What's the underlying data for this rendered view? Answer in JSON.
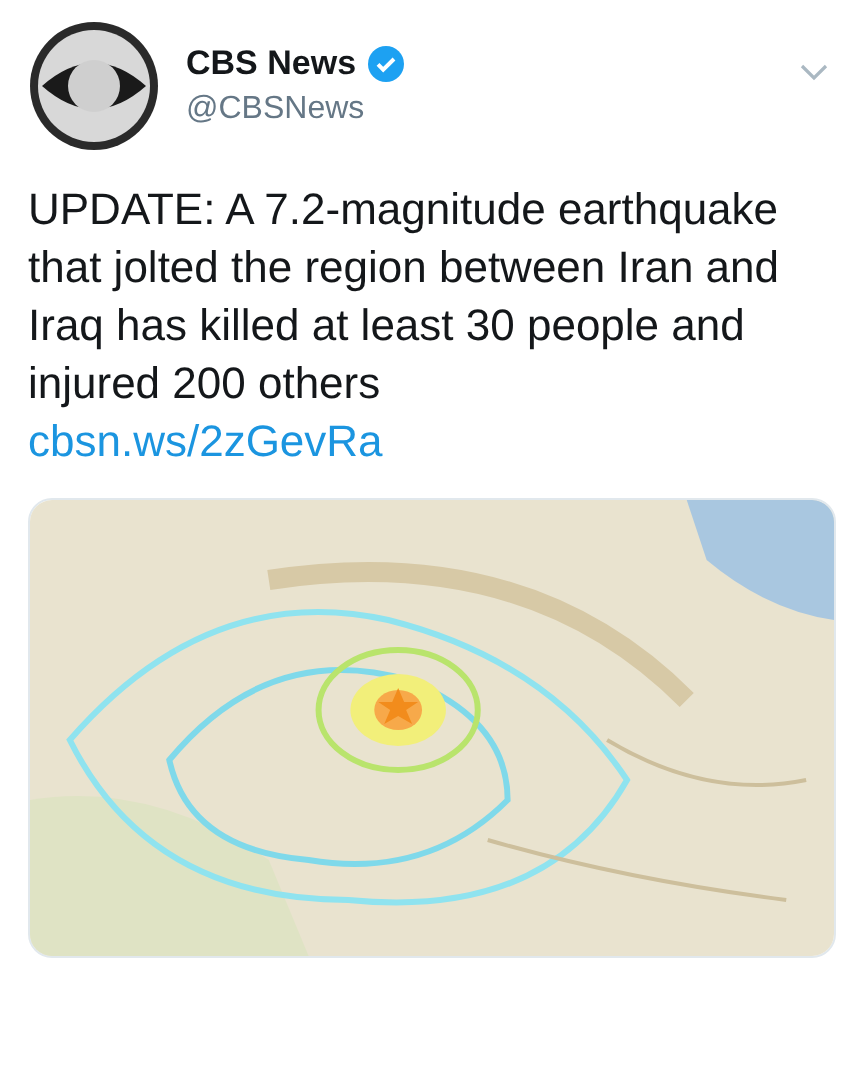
{
  "author": {
    "name": "CBS News",
    "verified": true,
    "handle": "@CBSNews"
  },
  "text": "UPDATE: A 7.2-magnitude earthquake that jolted the region between Iran and Iraq has killed at least 30 people and injured 200 others",
  "link": "cbsn.ws/2zGevRa"
}
